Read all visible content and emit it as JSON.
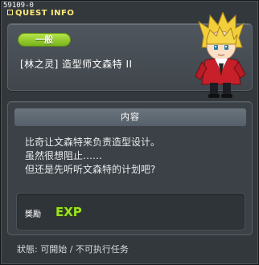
{
  "window": {
    "quest_id": "59109-0",
    "title": "QUEST INFO"
  },
  "header": {
    "category": "一般",
    "quest_name": "[林之灵] 造型师文森特 II"
  },
  "content": {
    "section_title": "内容",
    "description": [
      "比奇让文森特来负责造型设计。",
      "虽然很想阻止……",
      "但还是先听听文森特的计划吧?"
    ],
    "reward_label": "獎勵",
    "reward_icon_text": "EXP"
  },
  "status": "狀態: 可開始 / 不可执行任务",
  "colors": {
    "title": "#ffe978",
    "badge": "#8ac826",
    "exp_green": "#9be024",
    "exp_yellow": "#f3e63c"
  },
  "icons": [
    "npc-portrait",
    "exp-icon"
  ]
}
